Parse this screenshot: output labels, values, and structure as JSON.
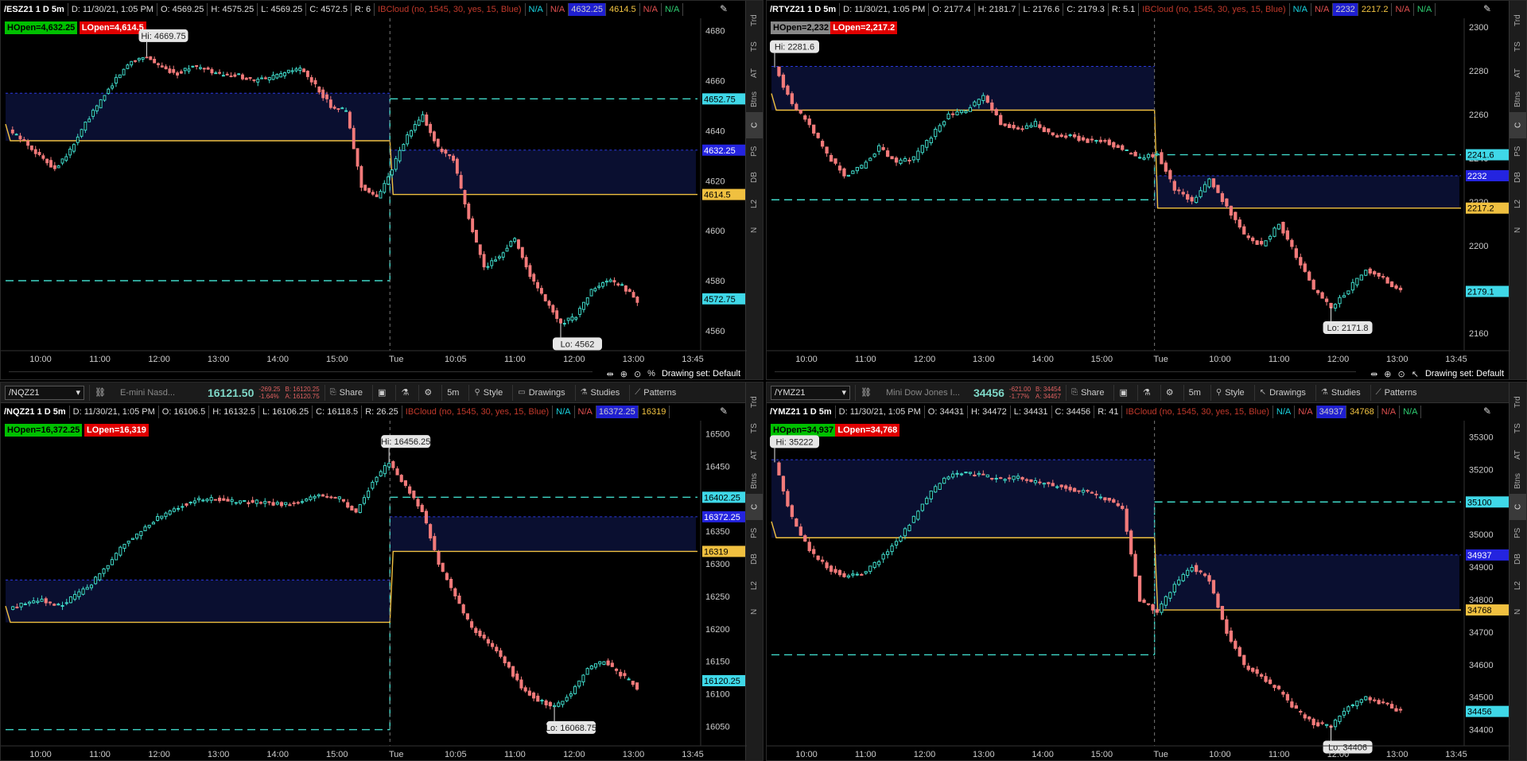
{
  "colors": {
    "bg": "#000000",
    "up": "#3fd8c8",
    "down": "#f27a7a",
    "cyan_line": "#3fd8c8",
    "gold_line": "#f0c040",
    "blue_line": "#2a38e0",
    "cloud": "#0a0f30"
  },
  "right_tabs": [
    "Trd",
    "TS",
    "AT",
    "Btns",
    "C",
    "PS",
    "DB",
    "L2",
    "N"
  ],
  "panels": [
    {
      "id": "es",
      "toolbar": null,
      "header": {
        "symbol": "/ESZ21 1 D 5m",
        "d": "D: 11/30/21, 1:05 PM",
        "o": "O: 4569.25",
        "h": "H: 4575.25",
        "l": "L: 4569.25",
        "c": "C: 4572.5",
        "r": "R: 6",
        "study": "IBCloud (no, 1545, 30, yes, 15, Blue)",
        "v1": "N/A",
        "v2": "N/A",
        "v3": "4632.25",
        "v4": "4614.5",
        "v5": "N/A",
        "v6": "N/A"
      },
      "hopen": "HOpen=4,632.25",
      "lopen": "LOpen=4,614.5",
      "hopen_gray": false,
      "hi_label": "Hi: 4669.75",
      "lo_label": "Lo: 4562",
      "price_labels": [
        {
          "text": "4652.75",
          "value": 4652.75,
          "color": "cyan"
        },
        {
          "text": "4632.25",
          "value": 4632.25,
          "color": "blue"
        },
        {
          "text": "4614.5",
          "value": 4614.5,
          "color": "gold"
        },
        {
          "text": "4572.75",
          "value": 4572.75,
          "color": "cyan"
        }
      ],
      "bottom": {
        "drawing_set": "Drawing set: Default"
      }
    },
    {
      "id": "rty",
      "toolbar": null,
      "header": {
        "symbol": "/RTYZ21 1 D 5m",
        "d": "D: 11/30/21, 1:05 PM",
        "o": "O: 2177.4",
        "h": "H: 2181.7",
        "l": "L: 2176.6",
        "c": "C: 2179.3",
        "r": "R: 5.1",
        "study": "IBCloud (no, 1545, 30, yes, 15, Blue)",
        "v1": "N/A",
        "v2": "N/A",
        "v3": "2232",
        "v4": "2217.2",
        "v5": "N/A",
        "v6": "N/A"
      },
      "hopen": "HOpen=2,232",
      "lopen": "LOpen=2,217.2",
      "hopen_gray": true,
      "hi_label": "Hi: 2281.6",
      "lo_label": "Lo: 2171.8",
      "price_labels": [
        {
          "text": "2241.6",
          "value": 2241.6,
          "color": "cyan"
        },
        {
          "text": "2232",
          "value": 2232,
          "color": "blue"
        },
        {
          "text": "2217.2",
          "value": 2217.2,
          "color": "gold"
        },
        {
          "text": "2179.1",
          "value": 2179.1,
          "color": "cyan"
        }
      ],
      "bottom": {
        "drawing_set": "Drawing set: Default"
      }
    },
    {
      "id": "nq",
      "toolbar": {
        "symbol": "/NQZ21",
        "desc": "E-mini Nasd...",
        "last": "16121.50",
        "chg1": "-269.25",
        "chg2": "-1.64%",
        "bid": "B: 16120.25",
        "ask": "A: 16120.75",
        "share": "Share",
        "tf": "5m",
        "style": "Style",
        "drawings": "Drawings",
        "studies": "Studies",
        "patterns": "Patterns"
      },
      "header": {
        "symbol": "/NQZ21 1 D 5m",
        "d": "D: 11/30/21, 1:05 PM",
        "o": "O: 16106.5",
        "h": "H: 16132.5",
        "l": "L: 16106.25",
        "c": "C: 16118.5",
        "r": "R: 26.25",
        "study": "IBCloud (no, 1545, 30, yes, 15, Blue)",
        "v1": "N/A",
        "v2": "N/A",
        "v3": "16372.25",
        "v4": "16319",
        "v5": "",
        "v6": ""
      },
      "hopen": "HOpen=16,372.25",
      "lopen": "LOpen=16,319",
      "hopen_gray": false,
      "hi_label": "Hi: 16456.25",
      "lo_label": "Lo: 16068.75",
      "price_labels": [
        {
          "text": "16402.25",
          "value": 16402.25,
          "color": "cyan"
        },
        {
          "text": "16372.25",
          "value": 16372.25,
          "color": "blue"
        },
        {
          "text": "16319",
          "value": 16319,
          "color": "gold"
        },
        {
          "text": "16120.25",
          "value": 16120.25,
          "color": "cyan"
        }
      ],
      "bottom": null
    },
    {
      "id": "ym",
      "toolbar": {
        "symbol": "/YMZ21",
        "desc": "Mini Dow Jones I...",
        "last": "34456",
        "chg1": "-621.00",
        "chg2": "-1.77%",
        "bid": "B: 34454",
        "ask": "A: 34457",
        "share": "Share",
        "tf": "5m",
        "style": "Style",
        "drawings": "Drawings",
        "studies": "Studies",
        "patterns": "Patterns"
      },
      "header": {
        "symbol": "/YMZ21 1 D 5m",
        "d": "D: 11/30/21, 1:05 PM",
        "o": "O: 34431",
        "h": "H: 34472",
        "l": "L: 34431",
        "c": "C: 34456",
        "r": "R: 41",
        "study": "IBCloud (no, 1545, 30, yes, 15, Blue)",
        "v1": "N/A",
        "v2": "N/A",
        "v3": "34937",
        "v4": "34768",
        "v5": "N/A",
        "v6": "N/A"
      },
      "hopen": "HOpen=34,937",
      "lopen": "LOpen=34,768",
      "hopen_gray": false,
      "hi_label": "Hi: 35222",
      "lo_label": "Lo: 34406",
      "price_labels": [
        {
          "text": "35100",
          "value": 35100,
          "color": "cyan"
        },
        {
          "text": "34937",
          "value": 34937,
          "color": "blue"
        },
        {
          "text": "34768",
          "value": 34768,
          "color": "gold"
        },
        {
          "text": "34456",
          "value": 34456,
          "color": "cyan"
        }
      ],
      "bottom": null
    }
  ],
  "chart_data": [
    {
      "type": "candlestick",
      "title": "/ESZ21 1 D 5m",
      "x_ticks": [
        "10:00",
        "11:00",
        "12:00",
        "13:00",
        "14:00",
        "15:00",
        "Tue",
        "10:05",
        "11:00",
        "12:00",
        "13:00",
        "13:45"
      ],
      "y_ticks": [
        4560,
        4580,
        4600,
        4620,
        4640,
        4660,
        4680
      ],
      "ylim": [
        4552,
        4685
      ],
      "session_break_index": 6,
      "cyan_upper_prev": 4657,
      "cyan_lower_prev": 4580,
      "gold_prev": 4636,
      "cloud_prev": [
        4636,
        4655
      ],
      "cyan_upper": 4652.75,
      "gold": 4614.5,
      "blue_top": 4632.25,
      "path": [
        4640,
        4636,
        4630,
        4625,
        4632,
        4643,
        4652,
        4661,
        4668,
        4669.75,
        4665,
        4663,
        4666,
        4664,
        4662,
        4662,
        4660,
        4661,
        4663,
        4665,
        4658,
        4650,
        4648,
        4618,
        4613,
        4625,
        4638,
        4646,
        4633,
        4628,
        4605,
        4585,
        4590,
        4597,
        4582,
        4572,
        4563,
        4566,
        4576,
        4580,
        4578,
        4572
      ]
    },
    {
      "type": "candlestick",
      "title": "/RTYZ21 1 D 5m",
      "x_ticks": [
        "10:00",
        "11:00",
        "12:00",
        "13:00",
        "14:00",
        "15:00",
        "Tue",
        "10:00",
        "11:00",
        "12:00",
        "13:00",
        "13:45"
      ],
      "y_ticks": [
        2160,
        2180,
        2200,
        2220,
        2240,
        2260,
        2280,
        2300
      ],
      "ylim": [
        2152,
        2304
      ],
      "session_break_index": 6,
      "cyan_upper_prev": 2241.6,
      "cyan_lower_prev": 2221,
      "gold_prev": 2262,
      "cloud_prev": [
        2262,
        2282
      ],
      "cyan_upper": 2241.6,
      "gold": 2217.2,
      "blue_top": 2232,
      "path": [
        2281.6,
        2265,
        2255,
        2242,
        2232,
        2236,
        2245,
        2238,
        2240,
        2250,
        2260,
        2262,
        2268,
        2256,
        2253,
        2256,
        2250,
        2250,
        2248,
        2248,
        2244,
        2240,
        2242,
        2226,
        2220,
        2230,
        2218,
        2205,
        2200,
        2210,
        2195,
        2180,
        2172,
        2180,
        2189,
        2185,
        2179
      ]
    },
    {
      "type": "candlestick",
      "title": "/NQZ21 1 D 5m",
      "x_ticks": [
        "10:00",
        "11:00",
        "12:00",
        "13:00",
        "14:00",
        "15:00",
        "Tue",
        "10:05",
        "11:00",
        "12:00",
        "13:00",
        "13:45"
      ],
      "y_ticks": [
        16050,
        16100,
        16150,
        16200,
        16250,
        16300,
        16350,
        16400,
        16450,
        16500
      ],
      "ylim": [
        16020,
        16520
      ],
      "session_break_index": 6,
      "cyan_upper_prev": 16402.25,
      "cyan_lower_prev": 16045,
      "gold_prev": 16210,
      "cloud_prev": [
        16210,
        16275
      ],
      "cyan_upper": 16402.25,
      "gold": 16319,
      "blue_top": 16372.25,
      "path": [
        16230,
        16240,
        16245,
        16235,
        16250,
        16270,
        16300,
        16330,
        16350,
        16370,
        16385,
        16395,
        16400,
        16398,
        16395,
        16395,
        16392,
        16392,
        16400,
        16405,
        16400,
        16380,
        16425,
        16456.25,
        16420,
        16380,
        16300,
        16250,
        16200,
        16180,
        16150,
        16110,
        16090,
        16080,
        16100,
        16140,
        16150,
        16130,
        16110
      ]
    },
    {
      "type": "candlestick",
      "title": "/YMZ21 1 D 5m",
      "x_ticks": [
        "10:00",
        "11:00",
        "12:00",
        "13:00",
        "14:00",
        "15:00",
        "Tue",
        "10:00",
        "11:00",
        "12:00",
        "13:00",
        "13:45"
      ],
      "y_ticks": [
        34400,
        34500,
        34600,
        34700,
        34800,
        34900,
        35000,
        35100,
        35200,
        35300
      ],
      "ylim": [
        34350,
        35350
      ],
      "session_break_index": 6,
      "cyan_upper_prev": 35100,
      "cyan_lower_prev": 34630,
      "gold_prev": 34990,
      "cloud_prev": [
        34990,
        35230
      ],
      "cyan_upper": 35100,
      "gold": 34768,
      "blue_top": 34937,
      "path": [
        35222,
        35050,
        34950,
        34900,
        34870,
        34880,
        34920,
        34980,
        35050,
        35130,
        35180,
        35190,
        35180,
        35170,
        35175,
        35160,
        35150,
        35140,
        35130,
        35110,
        35080,
        34800,
        34760,
        34850,
        34900,
        34860,
        34700,
        34600,
        34560,
        34520,
        34460,
        34420,
        34410,
        34470,
        34500,
        34480,
        34456
      ]
    }
  ]
}
